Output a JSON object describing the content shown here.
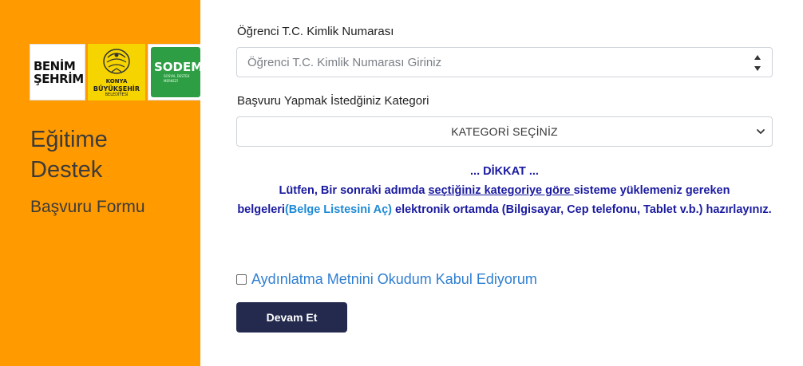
{
  "sidebar": {
    "logos": {
      "benim_line1": "BENİM",
      "benim_line2": "ŞEHRİM",
      "konya_line1": "KONYA",
      "konya_line2": "BÜYÜKŞEHİR",
      "konya_line3": "BELEDİYESİ",
      "sodem_line1": "SODEM",
      "sodem_line2": "SOSYAL DESTEK MERKEZİ"
    },
    "title_line1": "Eğitime",
    "title_line2": "Destek",
    "subtitle": "Başvuru Formu",
    "background_color": "#ff9a00"
  },
  "form": {
    "id_label": "Öğrenci T.C. Kimlik Numarası",
    "id_placeholder": "Öğrenci T.C. Kimlik Numarası Giriniz",
    "id_value": "",
    "category_label": "Başvuru Yapmak İstedğiniz Kategori",
    "category_selected": "KATEGORİ SEÇİNİZ",
    "notice": {
      "heading": "... DİKKAT ...",
      "part1": "Lütfen, Bir sonraki adımda ",
      "part2_underlined": "seçtiğiniz kategoriye göre ",
      "part3": "sisteme yüklemeniz gereken belgeleri",
      "link_text": "(Belge Listesini Aç)",
      "part4": " elektronik ortamda (Bilgisayar, Cep telefonu, Tablet v.b.) hazırlayınız."
    },
    "consent_label": "Aydınlatma Metnini Okudum Kabul Ediyorum",
    "consent_checked": false,
    "submit_label": "Devam Et"
  },
  "icons": {
    "spinner": "number-spinner-icon",
    "select_arrow": "chevron-down-icon",
    "konya_emblem": "konya-emblem-icon"
  },
  "colors": {
    "accent_orange": "#ff9a00",
    "button_navy": "#232a4d",
    "notice_blue": "#1a1aa0",
    "link_blue": "#1e8ad6"
  }
}
